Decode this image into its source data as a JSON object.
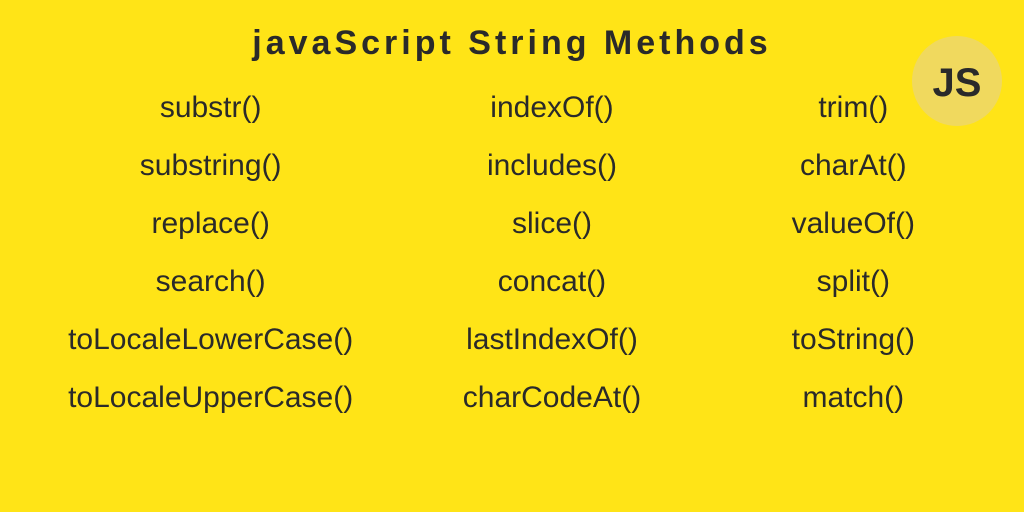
{
  "title": "javaScript String Methods",
  "badge": "JS",
  "columns": {
    "col1": [
      "substr()",
      "substring()",
      "replace()",
      "search()",
      "toLocaleLowerCase()",
      "toLocaleUpperCase()"
    ],
    "col2": [
      "indexOf()",
      "includes()",
      "slice()",
      "concat()",
      "lastIndexOf()",
      "charCodeAt()"
    ],
    "col3": [
      "trim()",
      "charAt()",
      "valueOf()",
      "split()",
      "toString()",
      "match()"
    ]
  }
}
